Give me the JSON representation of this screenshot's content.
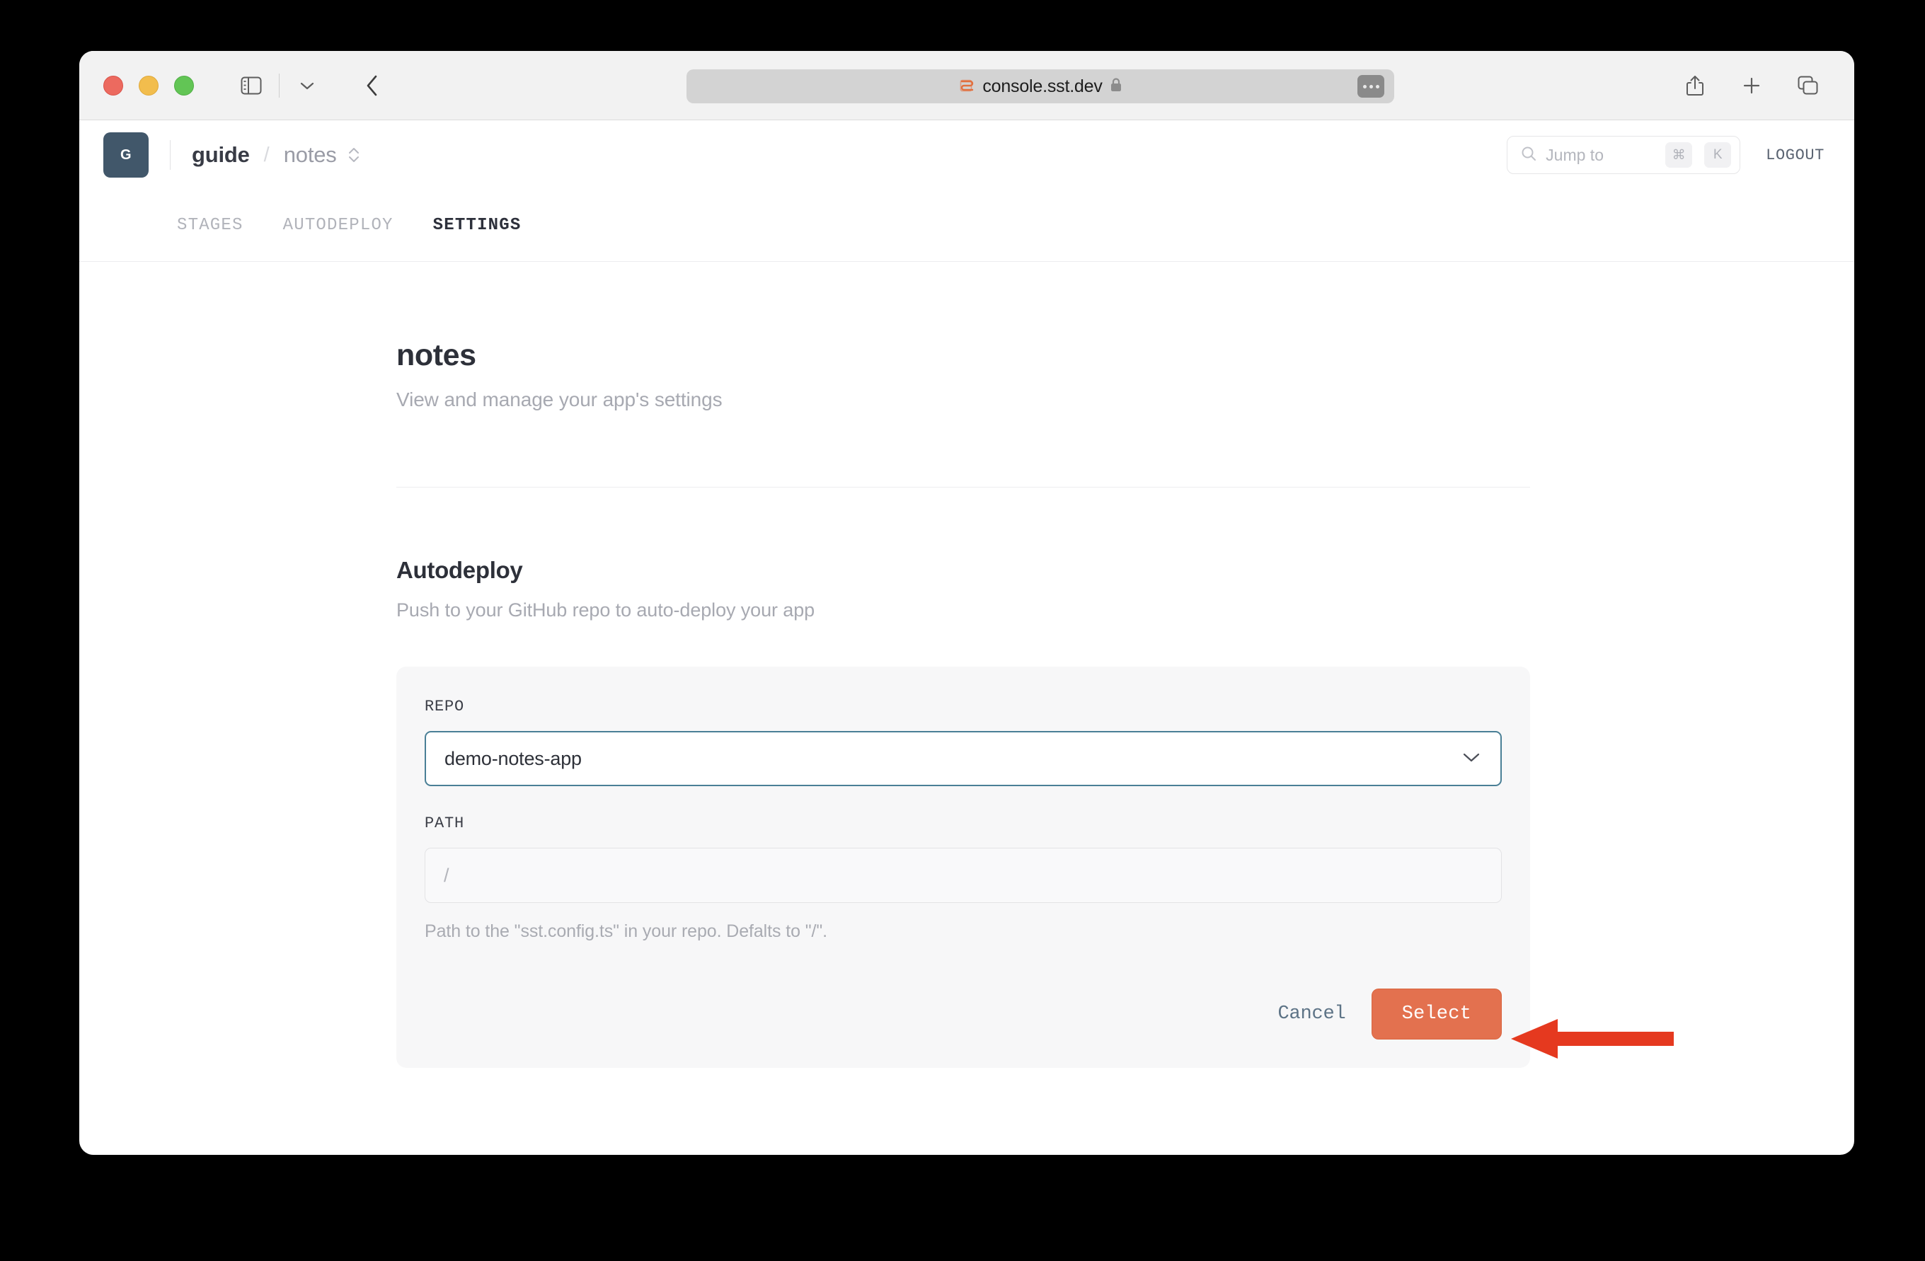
{
  "browser": {
    "url": "console.sst.dev",
    "icons": {
      "sidebar": "sidebar-icon",
      "sidebar_chevron": "chevron-down-icon",
      "back": "back-chevron-icon",
      "favicon": "sst-favicon-icon",
      "lock": "lock-icon",
      "ellipsis": "ellipsis-icon",
      "share": "share-icon",
      "new_tab": "plus-icon",
      "tab_overview": "tab-overview-icon"
    }
  },
  "header": {
    "avatar_initial": "G",
    "app_name": "guide",
    "separator": "/",
    "stage_name": "notes",
    "search": {
      "placeholder": "Jump to",
      "key_cmd": "⌘",
      "key_letter": "K"
    },
    "logout_label": "LOGOUT"
  },
  "tabs": [
    {
      "label": "STAGES",
      "active": false
    },
    {
      "label": "AUTODEPLOY",
      "active": false
    },
    {
      "label": "SETTINGS",
      "active": true
    }
  ],
  "main": {
    "title": "notes",
    "subtitle": "View and manage your app's settings",
    "section": {
      "title": "Autodeploy",
      "subtitle": "Push to your GitHub repo to auto-deploy your app"
    },
    "form": {
      "repo_label": "REPO",
      "repo_value": "demo-notes-app",
      "path_label": "PATH",
      "path_value": "",
      "path_placeholder": "/",
      "path_help": "Path to the \"sst.config.ts\" in your repo. Defalts to \"/\".",
      "cancel_label": "Cancel",
      "submit_label": "Select"
    }
  },
  "colors": {
    "accent_orange": "#e3714f",
    "annotation_red": "#e5391f",
    "avatar_bg": "#41576a",
    "focus_border": "#4a7f96"
  }
}
